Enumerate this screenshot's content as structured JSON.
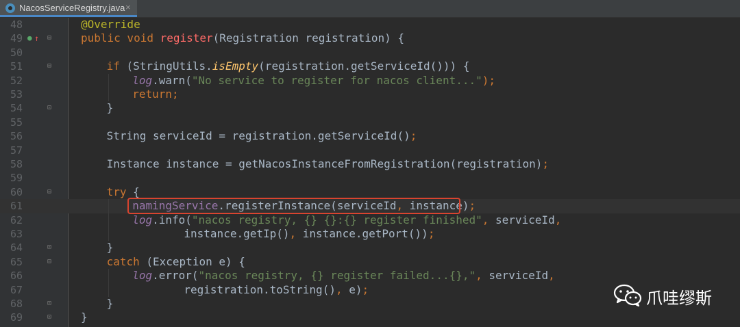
{
  "tab": {
    "filename": "NacosServiceRegistry.java",
    "close_glyph": "×"
  },
  "watermark": {
    "text": "爪哇缪斯"
  },
  "lines": [
    {
      "n": "48",
      "indent": 0,
      "tokens": [
        {
          "t": "@Override",
          "c": "ann"
        }
      ]
    },
    {
      "n": "49",
      "indent": 0,
      "tokens": [
        {
          "t": "public void ",
          "c": "kw"
        },
        {
          "t": "register",
          "c": "fn"
        },
        {
          "t": "(Registration registration) {",
          "c": ""
        }
      ]
    },
    {
      "n": "50",
      "indent": 0,
      "tokens": []
    },
    {
      "n": "51",
      "indent": 1,
      "tokens": [
        {
          "t": "if ",
          "c": "kw"
        },
        {
          "t": "(StringUtils.",
          "c": ""
        },
        {
          "t": "isEmpty",
          "c": "mt"
        },
        {
          "t": "(registration.getServiceId())) {",
          "c": ""
        }
      ]
    },
    {
      "n": "52",
      "indent": 2,
      "tokens": [
        {
          "t": "log",
          "c": "fld"
        },
        {
          "t": ".warn(",
          "c": ""
        },
        {
          "t": "\"No service to register for nacos client...\"",
          "c": "str"
        },
        {
          "t": ");",
          "c": "kw"
        }
      ]
    },
    {
      "n": "53",
      "indent": 2,
      "tokens": [
        {
          "t": "return;",
          "c": "kw"
        }
      ]
    },
    {
      "n": "54",
      "indent": 1,
      "tokens": [
        {
          "t": "}",
          "c": ""
        }
      ]
    },
    {
      "n": "55",
      "indent": 0,
      "tokens": []
    },
    {
      "n": "56",
      "indent": 1,
      "tokens": [
        {
          "t": "String serviceId = registration.getServiceId()",
          "c": ""
        },
        {
          "t": ";",
          "c": "kw"
        }
      ]
    },
    {
      "n": "57",
      "indent": 0,
      "tokens": []
    },
    {
      "n": "58",
      "indent": 1,
      "tokens": [
        {
          "t": "Instance instance = getNacosInstanceFromRegistration(registration)",
          "c": ""
        },
        {
          "t": ";",
          "c": "kw"
        }
      ]
    },
    {
      "n": "59",
      "indent": 0,
      "tokens": []
    },
    {
      "n": "60",
      "indent": 1,
      "tokens": [
        {
          "t": "try ",
          "c": "kw"
        },
        {
          "t": "{",
          "c": ""
        }
      ]
    },
    {
      "n": "61",
      "indent": 2,
      "tokens": [
        {
          "t": "namingService",
          "c": "ref"
        },
        {
          "t": ".registerInstance(serviceId",
          "c": ""
        },
        {
          "t": ", ",
          "c": "kw"
        },
        {
          "t": "instance)",
          "c": ""
        },
        {
          "t": ";",
          "c": "kw"
        }
      ]
    },
    {
      "n": "62",
      "indent": 2,
      "tokens": [
        {
          "t": "log",
          "c": "fld"
        },
        {
          "t": ".info(",
          "c": ""
        },
        {
          "t": "\"nacos registry, {} {}:{} register finished\"",
          "c": "str"
        },
        {
          "t": ", ",
          "c": "kw"
        },
        {
          "t": "serviceId",
          "c": ""
        },
        {
          "t": ",",
          "c": "kw"
        }
      ]
    },
    {
      "n": "63",
      "indent": 4,
      "tokens": [
        {
          "t": "instance.getIp()",
          "c": ""
        },
        {
          "t": ", ",
          "c": "kw"
        },
        {
          "t": "instance.getPort())",
          "c": ""
        },
        {
          "t": ";",
          "c": "kw"
        }
      ]
    },
    {
      "n": "64",
      "indent": 1,
      "tokens": [
        {
          "t": "}",
          "c": ""
        }
      ]
    },
    {
      "n": "65",
      "indent": 1,
      "tokens": [
        {
          "t": "catch ",
          "c": "kw"
        },
        {
          "t": "(Exception e) {",
          "c": ""
        }
      ]
    },
    {
      "n": "66",
      "indent": 2,
      "tokens": [
        {
          "t": "log",
          "c": "fld"
        },
        {
          "t": ".error(",
          "c": ""
        },
        {
          "t": "\"nacos registry, {} register failed...{},\"",
          "c": "str"
        },
        {
          "t": ", ",
          "c": "kw"
        },
        {
          "t": "serviceId",
          "c": ""
        },
        {
          "t": ",",
          "c": "kw"
        }
      ]
    },
    {
      "n": "67",
      "indent": 4,
      "tokens": [
        {
          "t": "registration.toString()",
          "c": ""
        },
        {
          "t": ", ",
          "c": "kw"
        },
        {
          "t": "e)",
          "c": ""
        },
        {
          "t": ";",
          "c": "kw"
        }
      ]
    },
    {
      "n": "68",
      "indent": 1,
      "tokens": [
        {
          "t": "}",
          "c": ""
        }
      ]
    },
    {
      "n": "69",
      "indent": 0,
      "tokens": [
        {
          "t": "}",
          "c": ""
        }
      ]
    }
  ]
}
